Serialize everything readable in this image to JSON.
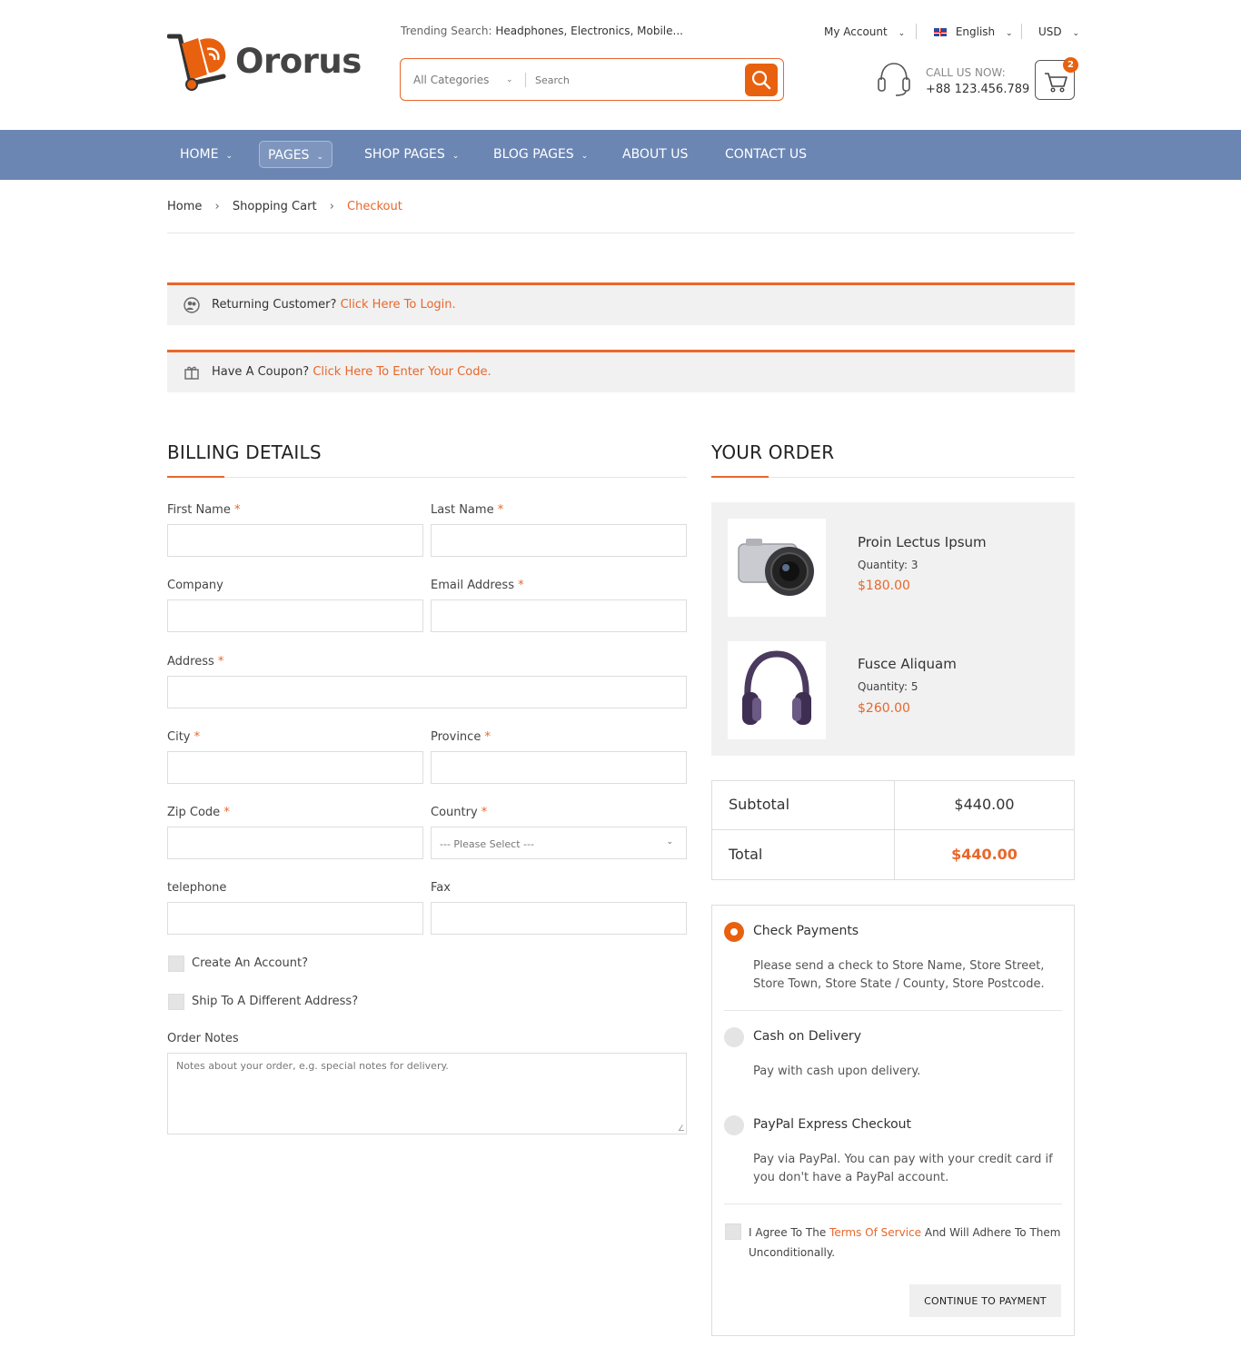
{
  "header": {
    "logo_text": "Ororus",
    "trending_prefix": "Trending Search:",
    "trending_terms": "Headphones, Electronics, Mobile...",
    "search": {
      "category": "All Categories",
      "placeholder": "Search"
    },
    "my_account": "My Account",
    "language": "English",
    "currency": "USD",
    "call_label": "CALL US NOW:",
    "call_number": "+88 123.456.789",
    "cart_count": "2"
  },
  "nav": {
    "items": [
      {
        "label": "HOME",
        "has_dropdown": true
      },
      {
        "label": "PAGES",
        "has_dropdown": true,
        "active": true
      },
      {
        "label": "SHOP PAGES",
        "has_dropdown": true
      },
      {
        "label": "BLOG PAGES",
        "has_dropdown": true
      },
      {
        "label": "ABOUT US",
        "has_dropdown": false
      },
      {
        "label": "CONTACT US",
        "has_dropdown": false
      }
    ]
  },
  "breadcrumb": [
    "Home",
    "Shopping Cart",
    "Checkout"
  ],
  "notices": {
    "returning": {
      "text": "Returning Customer?",
      "link": "Click Here To Login."
    },
    "coupon": {
      "text": "Have A Coupon?",
      "link": "Click Here To Enter Your Code."
    }
  },
  "billing": {
    "title": "BILLING DETAILS",
    "labels": {
      "first_name": "First Name",
      "last_name": "Last Name",
      "company": "Company",
      "email": "Email Address",
      "address": "Address",
      "city": "City",
      "province": "Province",
      "zip": "Zip Code",
      "country": "Country",
      "telephone": "telephone",
      "fax": "Fax"
    },
    "required_mark": "*",
    "country_placeholder": "--- Please Select ---",
    "create_account": "Create An Account?",
    "ship_different": "Ship To A Different Address?",
    "order_notes_label": "Order Notes",
    "order_notes_placeholder": "Notes about your order, e.g. special notes for delivery."
  },
  "order": {
    "title": "YOUR ORDER",
    "items": [
      {
        "name": "Proin Lectus Ipsum",
        "quantity": "Quantity: 3",
        "price": "$180.00"
      },
      {
        "name": "Fusce Aliquam",
        "quantity": "Quantity: 5",
        "price": "$260.00"
      }
    ],
    "subtotal_label": "Subtotal",
    "subtotal_value": "$440.00",
    "total_label": "Total",
    "total_value": "$440.00"
  },
  "payment": {
    "methods": [
      {
        "title": "Check Payments",
        "desc": "Please send a check to Store Name, Store Street, Store Town, Store State / County, Store Postcode.",
        "selected": true
      },
      {
        "title": "Cash on Delivery",
        "desc": "Pay with cash upon delivery.",
        "selected": false
      },
      {
        "title": "PayPal Express Checkout",
        "desc": "Pay via PayPal. You can pay with your credit card if you don't have a PayPal account.",
        "selected": false
      }
    ],
    "agree_prefix": "I Agree To The",
    "agree_link": "Terms Of Service",
    "agree_suffix": "And Will Adhere To Them Unconditionally.",
    "continue_label": "CONTINUE TO PAYMENT"
  },
  "colors": {
    "accent": "#e8672b",
    "nav_bg": "#6c86b3"
  }
}
